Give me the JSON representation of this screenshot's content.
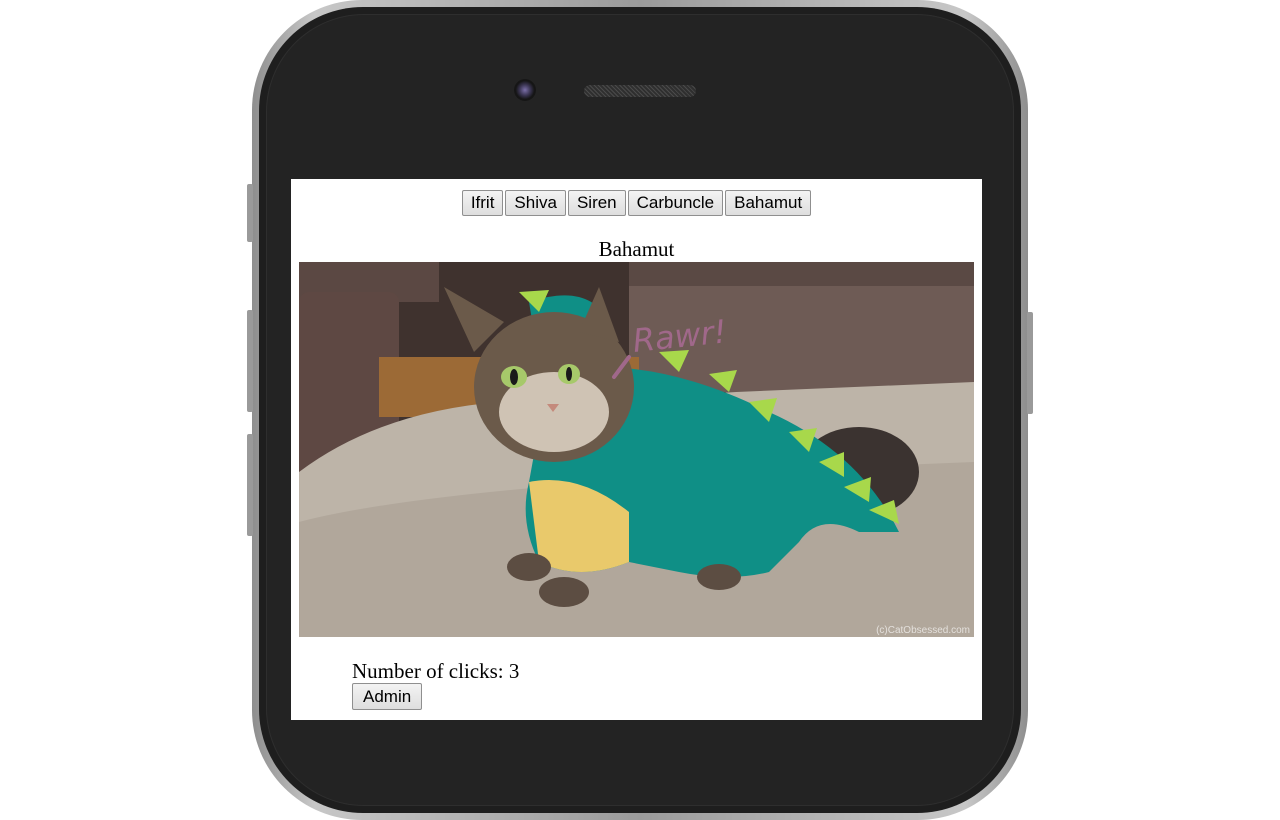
{
  "cat_buttons": [
    {
      "label": "Ifrit"
    },
    {
      "label": "Shiva"
    },
    {
      "label": "Siren"
    },
    {
      "label": "Carbuncle"
    },
    {
      "label": "Bahamut"
    }
  ],
  "selected_cat": {
    "name": "Bahamut",
    "image_watermark": "(c)CatObsessed.com",
    "image_caption_art": "Rawr!"
  },
  "clicks": {
    "label": "Number of clicks: 3"
  },
  "admin_button": {
    "label": "Admin"
  },
  "colors": {
    "phone_body": "#1e1e1e",
    "costume_teal": "#0f8f86",
    "spikes_green": "#a8d84b"
  }
}
